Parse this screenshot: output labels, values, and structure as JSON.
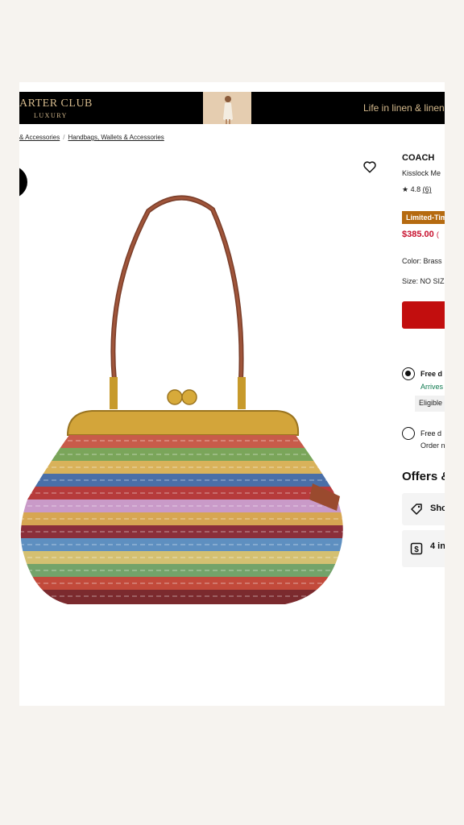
{
  "banner": {
    "brand": "ARTER CLUB",
    "brand_sub": "LUXURY",
    "tagline": "Life in linen & linen"
  },
  "breadcrumb": {
    "item1": "& Accessories",
    "separator": "/",
    "item2": "Handbags, Wallets & Accessories"
  },
  "product": {
    "brand": "COACH",
    "name": "Kisslock Me",
    "rating": "★ 4.8",
    "reviews": "(6)",
    "badge": "Limited-Time",
    "price": "$385.00",
    "price_extra": "(",
    "color": "Color: Brass",
    "size": "Size: NO SIZE"
  },
  "shipping": {
    "option1_title": "Free d",
    "option1_arrives": "Arrives",
    "option1_eligible": "Eligible",
    "option2_title": "Free d",
    "option2_sub": "Order n"
  },
  "offers": {
    "heading": "Offers &",
    "card1": "Sho",
    "card2": "4 in"
  },
  "colors": {
    "accent_red": "#c20e0e",
    "price_red": "#c8102e",
    "badge_orange": "#b56a10",
    "green": "#0f7a4f"
  }
}
